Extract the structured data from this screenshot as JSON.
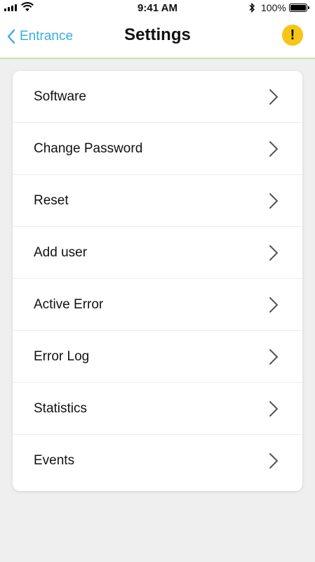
{
  "status_bar": {
    "time": "9:41 AM",
    "battery": "100%",
    "icons": [
      "signal-icon",
      "wifi-icon",
      "bluetooth-icon",
      "battery-icon"
    ]
  },
  "nav": {
    "back_label": "Entrance",
    "title": "Settings",
    "alert_symbol": "!"
  },
  "colors": {
    "accent": "#3aaee0",
    "alert": "#f5c518",
    "header_border": "#c9e3a6",
    "background": "#efefef"
  },
  "menu": [
    {
      "label": "Software",
      "icon": "chevron-right-icon"
    },
    {
      "label": "Change Password",
      "icon": "chevron-right-icon"
    },
    {
      "label": "Reset",
      "icon": "chevron-right-icon"
    },
    {
      "label": "Add user",
      "icon": "chevron-right-icon"
    },
    {
      "label": "Active Error",
      "icon": "chevron-right-icon"
    },
    {
      "label": "Error Log",
      "icon": "chevron-right-icon"
    },
    {
      "label": "Statistics",
      "icon": "chevron-right-icon"
    },
    {
      "label": "Events",
      "icon": "chevron-right-icon"
    }
  ]
}
